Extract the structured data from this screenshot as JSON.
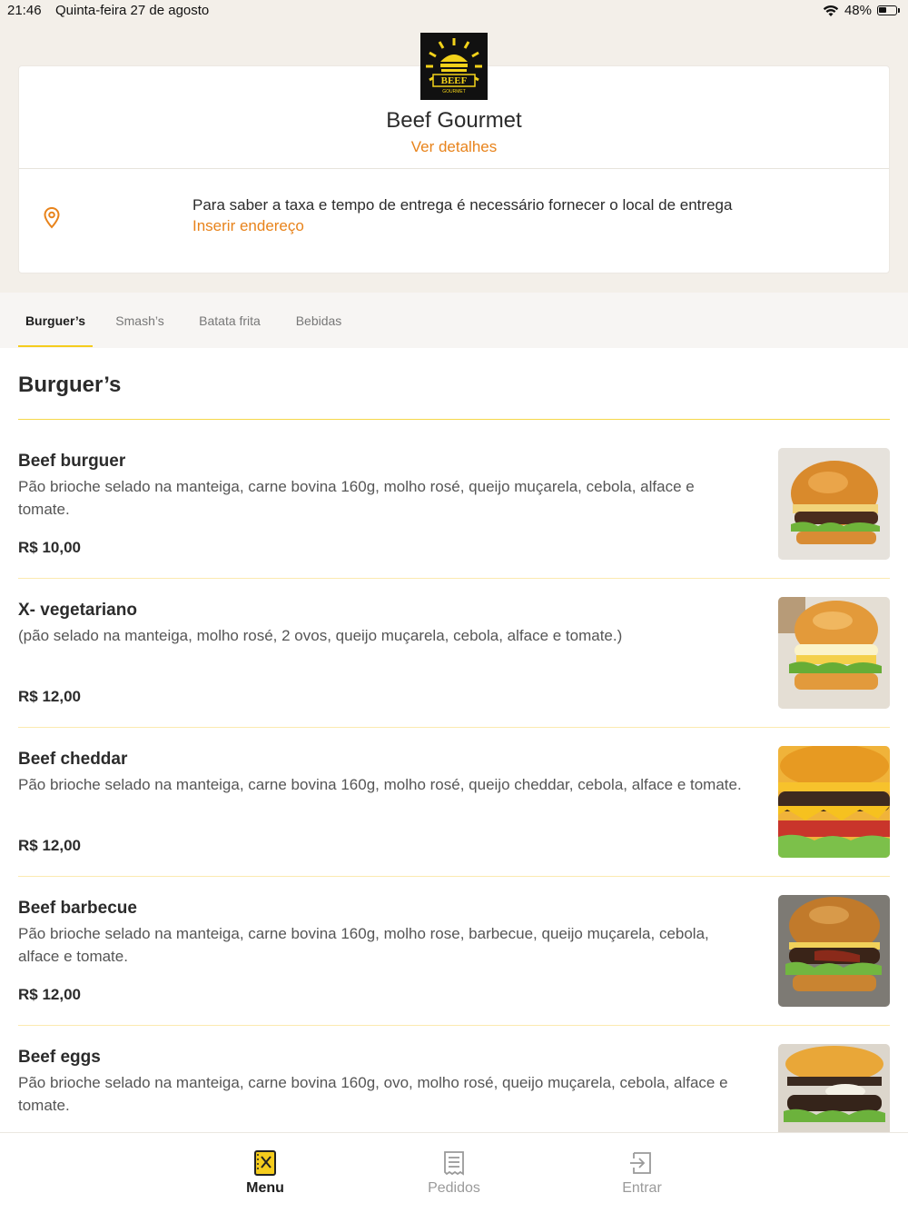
{
  "status_bar": {
    "time": "21:46",
    "date": "Quinta-feira 27 de agosto",
    "battery": "48%",
    "battery_level": 0.48
  },
  "store": {
    "logo_text": "BEEF",
    "logo_subtext": "GOURMET",
    "name": "Beef Gourmet",
    "details_link": "Ver detalhes",
    "delivery_info": "Para saber a taxa e tempo de entrega é necessário fornecer o local de entrega",
    "address_link": "Inserir endereço",
    "accent_color": "#e8831b"
  },
  "tabs": [
    {
      "label": "Burguer’s",
      "active": true
    },
    {
      "label": "Smash’s",
      "active": false
    },
    {
      "label": "Batata frita",
      "active": false
    },
    {
      "label": "Bebidas",
      "active": false
    }
  ],
  "section": {
    "title": "Burguer’s"
  },
  "items": [
    {
      "name": "Beef burguer",
      "description": "Pão brioche selado na manteiga, carne bovina 160g, molho rosé, queijo muçarela, cebola, alface e tomate.",
      "price": "R$ 10,00"
    },
    {
      "name": "X- vegetariano",
      "description": "(pão selado na manteiga, molho rosé, 2 ovos, queijo muçarela, cebola, alface e tomate.)",
      "price": "R$ 12,00"
    },
    {
      "name": "Beef cheddar",
      "description": "Pão brioche selado na manteiga, carne bovina 160g, molho rosé, queijo cheddar, cebola, alface e tomate.",
      "price": "R$ 12,00"
    },
    {
      "name": "Beef barbecue",
      "description": "Pão brioche selado na manteiga, carne bovina 160g, molho rose, barbecue, queijo muçarela, cebola, alface e tomate.",
      "price": "R$ 12,00"
    },
    {
      "name": "Beef eggs",
      "description": "Pão brioche selado na manteiga, carne bovina 160g, ovo, molho rosé, queijo muçarela, cebola, alface e tomate.",
      "price": ""
    }
  ],
  "bottom_nav": [
    {
      "label": "Menu",
      "icon": "menu-book-icon",
      "active": true
    },
    {
      "label": "Pedidos",
      "icon": "receipt-icon",
      "active": false
    },
    {
      "label": "Entrar",
      "icon": "login-icon",
      "active": false
    }
  ]
}
